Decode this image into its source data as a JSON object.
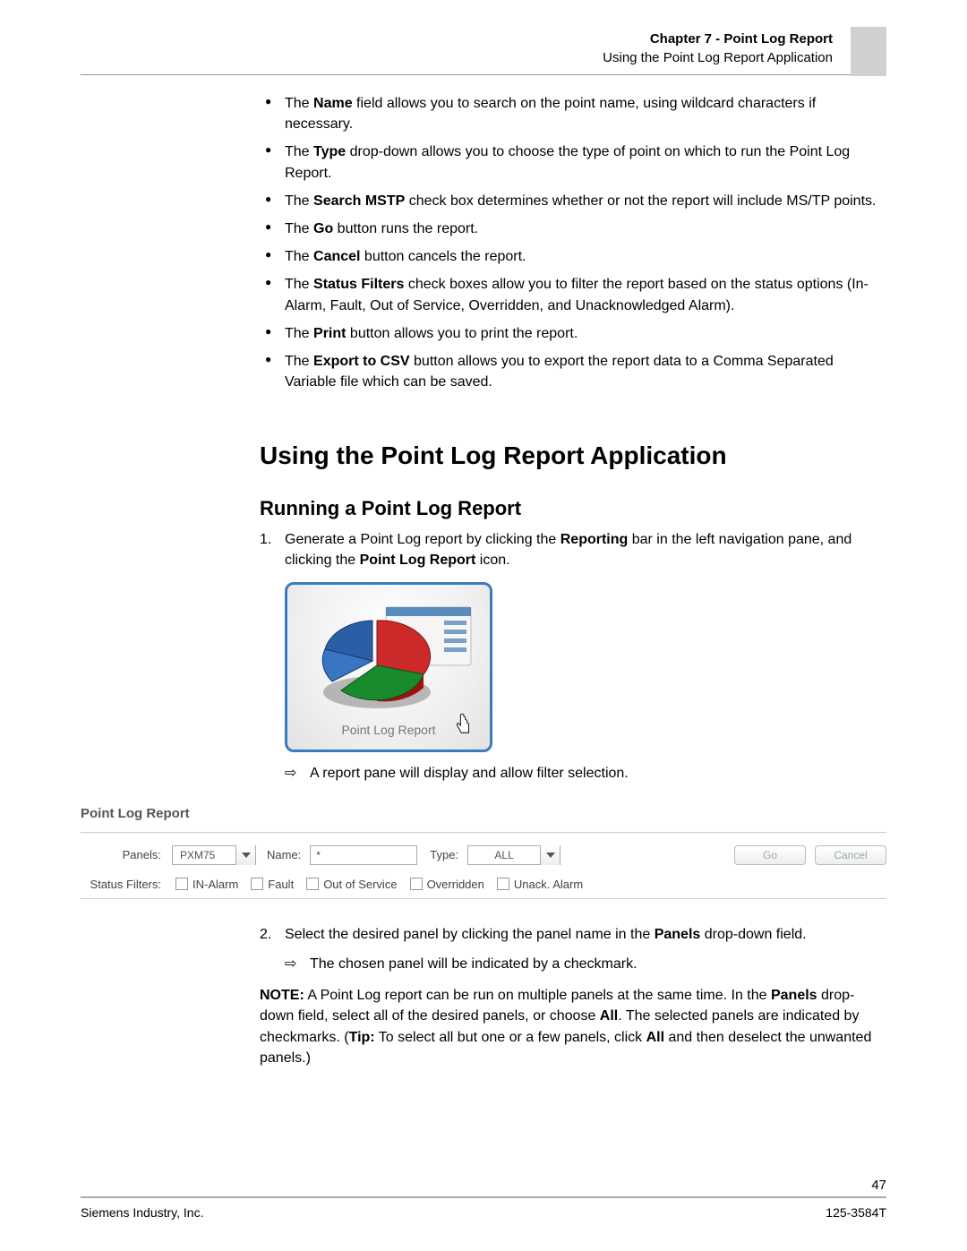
{
  "header": {
    "chapter": "Chapter 7 - Point Log Report",
    "subtitle": "Using the Point Log Report Application"
  },
  "bullets": [
    {
      "pre": "The ",
      "bold": "Name",
      "post": " field allows you to search on the point name, using wildcard characters if necessary."
    },
    {
      "pre": "The ",
      "bold": "Type",
      "post": " drop-down allows you to choose the type of point on which to run the Point Log Report."
    },
    {
      "pre": "The ",
      "bold": "Search MSTP",
      "post": " check box determines whether or not the report will include MS/TP points."
    },
    {
      "pre": "The ",
      "bold": "Go",
      "post": " button runs the report."
    },
    {
      "pre": "The ",
      "bold": "Cancel",
      "post": " button cancels the report."
    },
    {
      "pre": "The ",
      "bold": "Status Filters",
      "post": " check boxes allow you to filter the report based on the status options (In-Alarm, Fault, Out of Service, Overridden, and Unacknowledged Alarm)."
    },
    {
      "pre": "The ",
      "bold": "Print",
      "post": " button allows you to print the report."
    },
    {
      "pre": "The ",
      "bold": "Export to CSV",
      "post": " button allows you to export the report data to a Comma Separated Variable file which can be saved."
    }
  ],
  "h1": "Using the Point Log Report Application",
  "h2": "Running a Point Log Report",
  "step1_num": "1.",
  "step1_a": "Generate a Point Log report by clicking the ",
  "step1_b": "Reporting",
  "step1_c": " bar in the left navigation pane, and clicking the ",
  "step1_d": "Point Log Report",
  "step1_e": " icon.",
  "icon_label": "Point Log Report",
  "arrow1": "A report pane will display and allow filter selection.",
  "pane_title": "Point Log Report",
  "filters": {
    "panels_label": "Panels:",
    "panels_value": "PXM75",
    "name_label": "Name:",
    "name_value": "*",
    "type_label": "Type:",
    "type_value": "ALL",
    "go_label": "Go",
    "cancel_label": "Cancel",
    "sf_label": "Status Filters:",
    "c1": "IN-Alarm",
    "c2": "Fault",
    "c3": "Out of Service",
    "c4": "Overridden",
    "c5": "Unack. Alarm"
  },
  "step2_num": "2.",
  "step2_a": "Select the desired panel by clicking the panel name in the ",
  "step2_b": "Panels",
  "step2_c": " drop-down field.",
  "arrow2": "The chosen panel will be indicated by a checkmark.",
  "note_bold1": "NOTE:",
  "note_a": " A Point Log report can be run on multiple panels at the same time. In the ",
  "note_bold2": "Panels",
  "note_b": " drop-down field, select all of the desired panels, or choose ",
  "note_bold3": "All",
  "note_c": ". The selected panels are indicated by checkmarks. (",
  "note_bold4": "Tip:",
  "note_d": " To select all but one or a few panels, click ",
  "note_bold5": "All",
  "note_e": " and then deselect the unwanted panels.)",
  "page_num": "47",
  "footer_left": "Siemens Industry, Inc.",
  "footer_right": "125-3584T"
}
